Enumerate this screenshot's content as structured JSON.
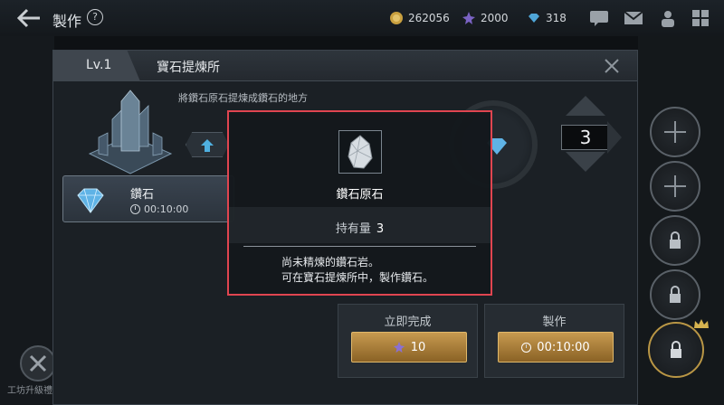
{
  "topbar": {
    "title": "製作",
    "help": "?",
    "resources": [
      {
        "icon": "gold-coin-icon",
        "value": "262056"
      },
      {
        "icon": "purple-crystal-icon",
        "value": "2000"
      },
      {
        "icon": "blue-diamond-icon",
        "value": "318"
      }
    ]
  },
  "dialog": {
    "level": "Lv.1",
    "title": "寶石提煉所",
    "description": "將鑽石原石提煉成鑽石的地方",
    "recipe": {
      "name": "鑽石",
      "time": "00:10:00"
    },
    "quantity": "3",
    "instant": {
      "label": "立即完成",
      "cost": "10"
    },
    "craft": {
      "label": "製作",
      "time": "00:10:00"
    }
  },
  "popup": {
    "item_name": "鑽石原石",
    "owned_label": "持有量",
    "owned_value": "3",
    "desc_line1": "尚未精煉的鑽石岩。",
    "desc_line2": "可在寶石提煉所中，製作鑽石。"
  },
  "background": {
    "bottom_left_label": "工坊升級禮包"
  },
  "colors": {
    "highlight_border": "#e04550",
    "gold_button": "#c79a50"
  }
}
